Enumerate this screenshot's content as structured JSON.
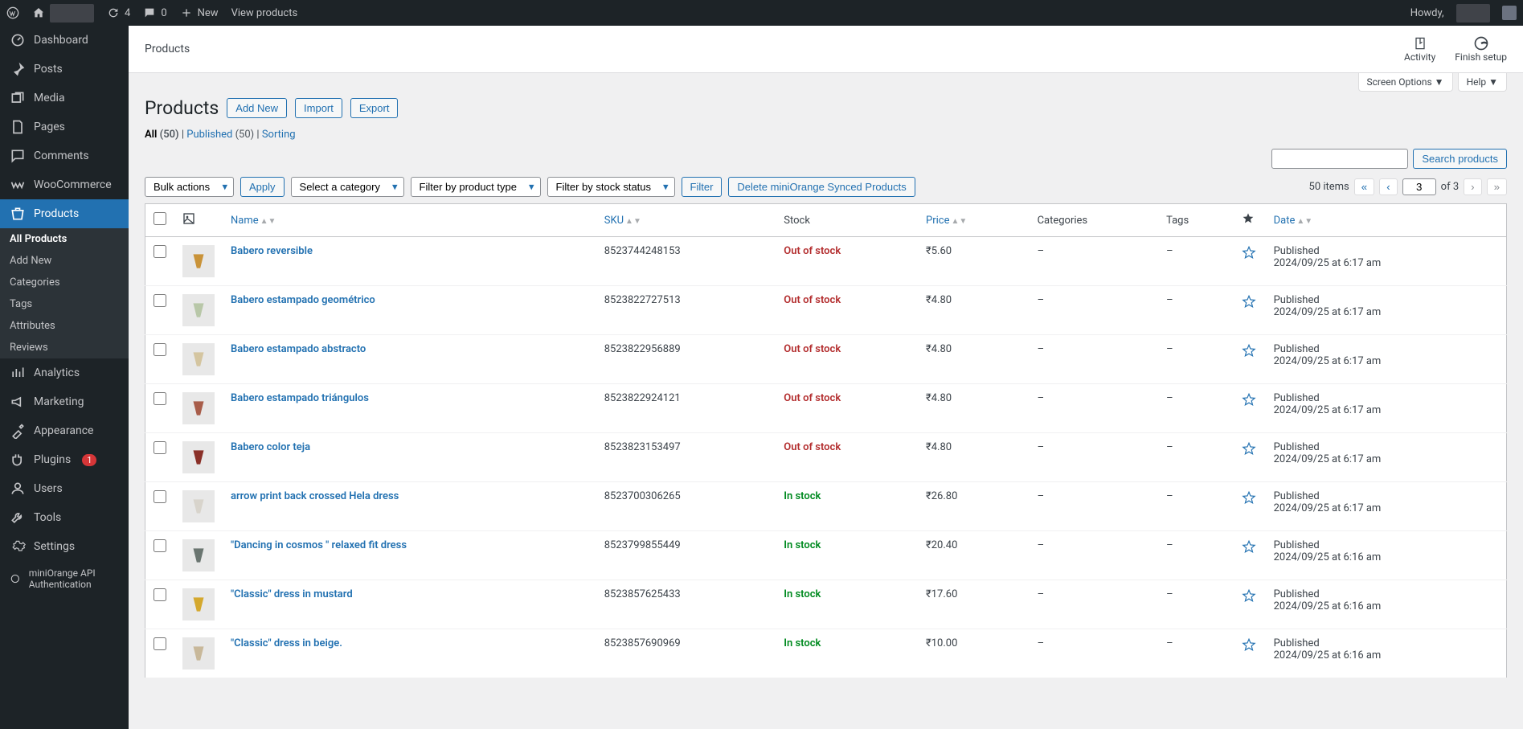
{
  "adminBar": {
    "updates": "4",
    "comments": "0",
    "newLabel": "New",
    "viewProducts": "View products",
    "howdy": "Howdy,"
  },
  "sidebar": {
    "dashboard": "Dashboard",
    "posts": "Posts",
    "media": "Media",
    "pages": "Pages",
    "commentsLabel": "Comments",
    "woocommerce": "WooCommerce",
    "products": "Products",
    "sub": {
      "allProducts": "All Products",
      "addNew": "Add New",
      "categories": "Categories",
      "tags": "Tags",
      "attributes": "Attributes",
      "reviews": "Reviews"
    },
    "analytics": "Analytics",
    "marketing": "Marketing",
    "appearance": "Appearance",
    "plugins": "Plugins",
    "pluginsCount": "1",
    "users": "Users",
    "tools": "Tools",
    "settings": "Settings",
    "miniorange": "miniOrange API Authentication"
  },
  "headerStrip": {
    "title": "Products",
    "activity": "Activity",
    "finishSetup": "Finish setup"
  },
  "screenTabs": {
    "screenOptions": "Screen Options ▼",
    "help": "Help ▼"
  },
  "pageTitle": {
    "title": "Products",
    "addNew": "Add New",
    "import": "Import",
    "export": "Export"
  },
  "subsubsub": {
    "all": "All",
    "allCount": "(50)",
    "published": "Published",
    "publishedCount": "(50)",
    "sorting": "Sorting",
    "sep": " | "
  },
  "search": {
    "button": "Search products"
  },
  "filters": {
    "bulkActions": "Bulk actions",
    "apply": "Apply",
    "selectCategory": "Select a category",
    "productType": "Filter by product type",
    "stockStatus": "Filter by stock status",
    "filter": "Filter",
    "deleteSynced": "Delete miniOrange Synced Products"
  },
  "pagination": {
    "itemsText": "50 items",
    "current": "3",
    "ofText": "of 3"
  },
  "tableHeaders": {
    "name": "Name",
    "sku": "SKU",
    "stock": "Stock",
    "price": "Price",
    "categories": "Categories",
    "tags": "Tags",
    "date": "Date"
  },
  "rows": [
    {
      "name": "Babero reversible",
      "sku": "8523744248153",
      "stock": "Out of stock",
      "stockClass": "out",
      "price": "₹5.60",
      "cat": "–",
      "tag": "–",
      "status": "Published",
      "date": "2024/09/25 at 6:17 am",
      "thumb": "#c99339"
    },
    {
      "name": "Babero estampado geométrico",
      "sku": "8523822727513",
      "stock": "Out of stock",
      "stockClass": "out",
      "price": "₹4.80",
      "cat": "–",
      "tag": "–",
      "status": "Published",
      "date": "2024/09/25 at 6:17 am",
      "thumb": "#b8c7a8"
    },
    {
      "name": "Babero estampado abstracto",
      "sku": "8523822956889",
      "stock": "Out of stock",
      "stockClass": "out",
      "price": "₹4.80",
      "cat": "–",
      "tag": "–",
      "status": "Published",
      "date": "2024/09/25 at 6:17 am",
      "thumb": "#d4c5a0"
    },
    {
      "name": "Babero estampado triángulos",
      "sku": "8523822924121",
      "stock": "Out of stock",
      "stockClass": "out",
      "price": "₹4.80",
      "cat": "–",
      "tag": "–",
      "status": "Published",
      "date": "2024/09/25 at 6:17 am",
      "thumb": "#a85d4a"
    },
    {
      "name": "Babero color teja",
      "sku": "8523823153497",
      "stock": "Out of stock",
      "stockClass": "out",
      "price": "₹4.80",
      "cat": "–",
      "tag": "–",
      "status": "Published",
      "date": "2024/09/25 at 6:17 am",
      "thumb": "#8a3028"
    },
    {
      "name": "arrow print back crossed Hela dress",
      "sku": "8523700306265",
      "stock": "In stock",
      "stockClass": "in",
      "price": "₹26.80",
      "cat": "–",
      "tag": "–",
      "status": "Published",
      "date": "2024/09/25 at 6:17 am",
      "thumb": "#d8d4cc"
    },
    {
      "name": "\"Dancing in cosmos \" relaxed fit dress",
      "sku": "8523799855449",
      "stock": "In stock",
      "stockClass": "in",
      "price": "₹20.40",
      "cat": "–",
      "tag": "–",
      "status": "Published",
      "date": "2024/09/25 at 6:16 am",
      "thumb": "#6a7570"
    },
    {
      "name": "\"Classic\" dress in mustard",
      "sku": "8523857625433",
      "stock": "In stock",
      "stockClass": "in",
      "price": "₹17.60",
      "cat": "–",
      "tag": "–",
      "status": "Published",
      "date": "2024/09/25 at 6:16 am",
      "thumb": "#d4a82e"
    },
    {
      "name": "\"Classic\" dress in beige.",
      "sku": "8523857690969",
      "stock": "In stock",
      "stockClass": "in",
      "price": "₹10.00",
      "cat": "–",
      "tag": "–",
      "status": "Published",
      "date": "2024/09/25 at 6:16 am",
      "thumb": "#c8b89a"
    }
  ]
}
